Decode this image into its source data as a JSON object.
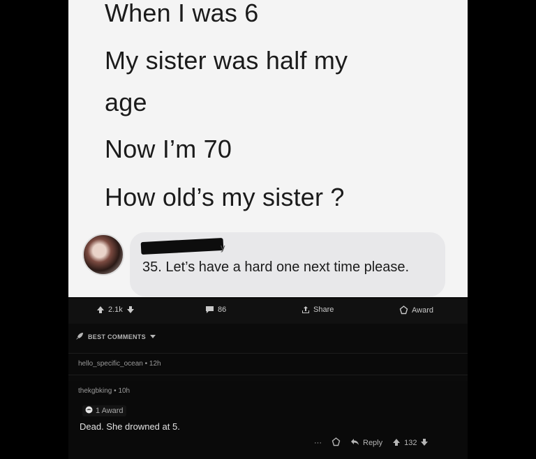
{
  "post": {
    "lines": [
      "When I was 6",
      "My sister was half my",
      "age",
      "Now I’m 70",
      "How old’s my sister ?"
    ],
    "reply_name_tail": "y",
    "reply_text": "35. Let’s have a hard one next time please."
  },
  "action_bar": {
    "vote_count": "2.1k",
    "comment_count": "86",
    "share_label": "Share",
    "award_label": "Award"
  },
  "sort": {
    "label": "BEST COMMENTS"
  },
  "comments": [
    {
      "author": "hello_specific_ocean",
      "age": "12h"
    },
    {
      "author": "thekgbking",
      "age": "10h",
      "award_label": "1 Award",
      "body": "Dead. She drowned at 5.",
      "more_label": "···",
      "reply_label": "Reply",
      "score": "132"
    }
  ],
  "colors": {
    "background": "#000000",
    "card": "#0a0a0a",
    "image_bg": "#f4f4f4",
    "text": "#d7dadc"
  }
}
